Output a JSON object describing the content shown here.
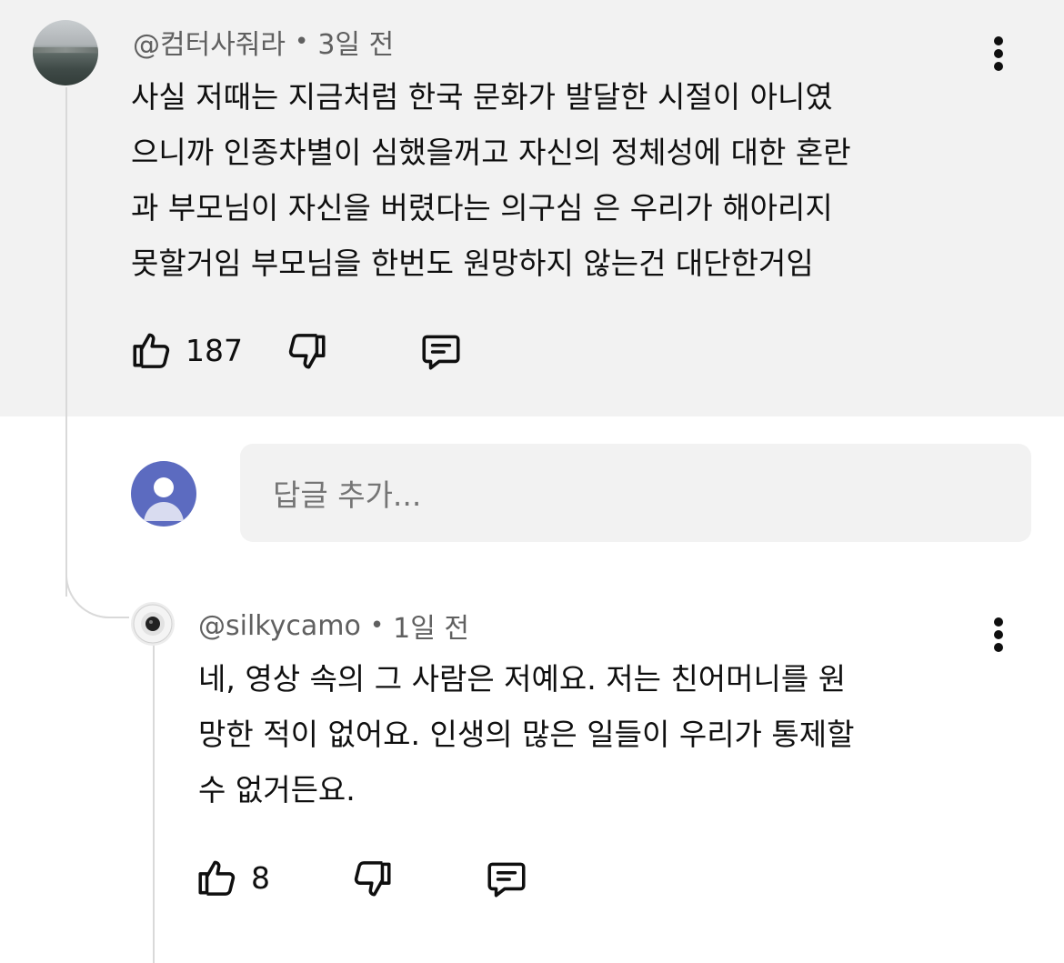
{
  "comment": {
    "author": "@컴터사줘라",
    "time": "3일 전",
    "lines": [
      "사실 저때는 지금처럼 한국 문화가 발달한 시절이 아니였",
      "으니까 인종차별이 심했을꺼고 자신의 정체성에 대한 혼란",
      "과 부모님이 자신을 버렸다는 의구심 은 우리가 해아리지",
      "못할거임 부모님을 한번도 원망하지 않는건 대단한거임"
    ],
    "likes": "187",
    "avatar_icon": "lake-photo-avatar"
  },
  "reply_box": {
    "placeholder": "답글 추가..."
  },
  "reply": {
    "author": "@silkycamo",
    "time": "1일 전",
    "lines": [
      "네, 영상 속의 그 사람은 저예요. 저는 친어머니를 원",
      "망한 적이 없어요. 인생의 많은 일들이 우리가 통제할",
      "수 없거든요."
    ],
    "likes": "8",
    "avatar_icon": "camera-lens-avatar"
  },
  "icons": {
    "like": "thumbs-up-icon",
    "dislike": "thumbs-down-icon",
    "reply": "comment-bubble-icon",
    "more": "vertical-dots-icon"
  },
  "colors": {
    "highlight_bg": "#f2f2f2",
    "meta_text": "#606060",
    "user_avatar": "#5c6bc0"
  }
}
